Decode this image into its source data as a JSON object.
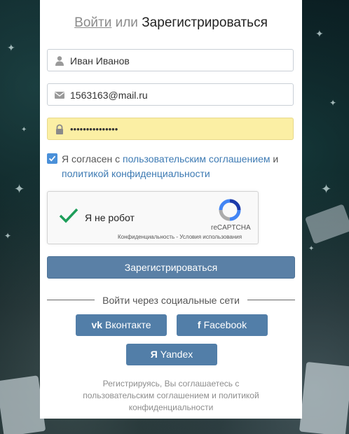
{
  "header": {
    "login_label": "Войти",
    "or_label": "или",
    "register_label": "Зарегистрироваться"
  },
  "form": {
    "name_value": "Иван Иванов",
    "email_value": "1563163@mail.ru",
    "password_value": "•••••••••••••••",
    "agree": {
      "checked": true,
      "prefix": "Я согласен с ",
      "terms_link": "пользовательским соглашением",
      "and": " и ",
      "privacy_link": "политикой конфиденциальности"
    },
    "recaptcha": {
      "label": "Я не робот",
      "brand": "reCAPTCHA",
      "links": "Конфиденциальность - Условия использования"
    },
    "submit_label": "Зарегистрироваться"
  },
  "social": {
    "heading": "Войти через социальные сети",
    "vk": {
      "symbol": "vk",
      "label": "Вконтакте"
    },
    "facebook": {
      "symbol": "f",
      "label": "Facebook"
    },
    "yandex": {
      "symbol": "Я",
      "label": "Yandex"
    }
  },
  "footer": {
    "text": "Регистрируясь, Вы соглашаетесь с пользовательским соглашением и политикой конфиденциальности"
  },
  "icons": {
    "name": "user-icon",
    "email": "envelope-icon",
    "password": "lock-icon"
  },
  "colors": {
    "primary_button": "#5a80a6",
    "social_button": "#527ea8",
    "link": "#3d7ab3",
    "password_bg": "#fbefa4",
    "checkbox": "#4a90d9"
  }
}
